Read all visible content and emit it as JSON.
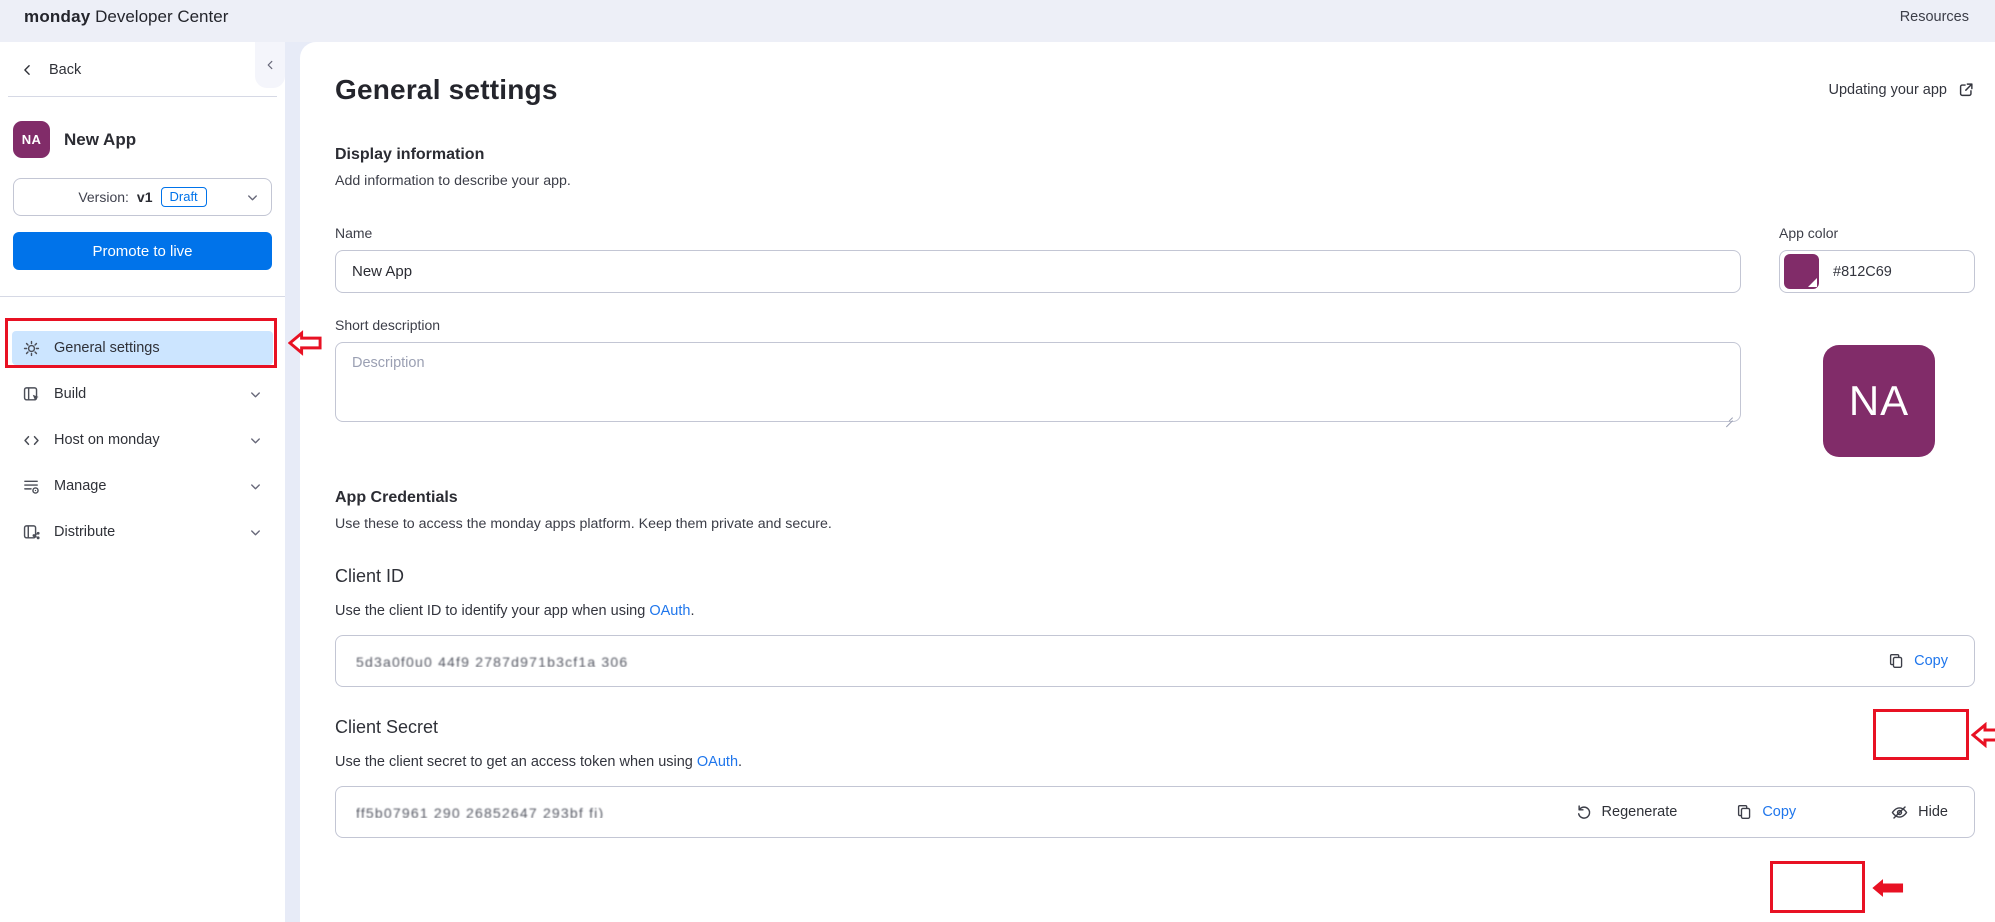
{
  "topbar": {
    "brand_bold": "monday",
    "brand_rest": " Developer Center",
    "resources_label": "Resources"
  },
  "sidebar": {
    "back_label": "Back",
    "app_initials": "NA",
    "app_name": "New App",
    "version_prefix": "Version:",
    "version_value": "v1",
    "version_badge": "Draft",
    "promote_label": "Promote to live",
    "items": [
      {
        "label": "General settings",
        "active": true
      },
      {
        "label": "Build"
      },
      {
        "label": "Host on monday"
      },
      {
        "label": "Manage"
      },
      {
        "label": "Distribute"
      }
    ]
  },
  "main": {
    "title": "General settings",
    "help_link_label": "Updating your app",
    "display": {
      "heading": "Display information",
      "subtitle": "Add information to describe your app.",
      "name_label": "Name",
      "name_value": "New App",
      "app_color_label": "App color",
      "app_color_value": "#812C69",
      "desc_label": "Short description",
      "desc_placeholder": "Description",
      "preview_initials": "NA"
    },
    "credentials": {
      "heading": "App Credentials",
      "subtitle": "Use these to access the monday apps platform. Keep them private and secure.",
      "client_id": {
        "heading": "Client ID",
        "desc_before": "Use the client ID to identify your app when using ",
        "link_label": "OAuth",
        "desc_after": ".",
        "masked_value": "5d3a0f0u0 44f9 2787d971b3cf1a 306",
        "copy_label": "Copy"
      },
      "client_secret": {
        "heading": "Client Secret",
        "desc_before": "Use the client secret to get an access token when using ",
        "link_label": "OAuth",
        "desc_after": ".",
        "masked_value": "ff5b07961 290 26852647 293bf   fi)",
        "regenerate_label": "Regenerate",
        "copy_label": "Copy",
        "hide_label": "Hide"
      }
    }
  },
  "colors": {
    "app_color": "#812C69",
    "accent": "#0073ea",
    "annotation": "#e81123",
    "link": "#1f76ec"
  }
}
